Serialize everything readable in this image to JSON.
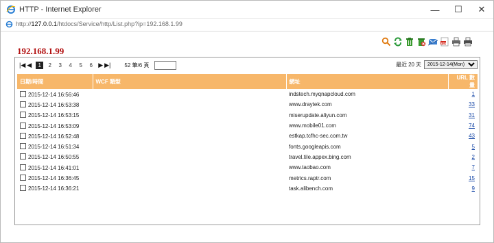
{
  "window": {
    "title": "HTTP - Internet Explorer",
    "minimize_glyph": "—",
    "maximize_glyph": "☐",
    "close_glyph": "✕"
  },
  "address_bar": {
    "url_prefix": "http://",
    "url_host": "127.0.0.1",
    "url_path": "/htdocs/Service/http/List.php?ip=192.168.1.99"
  },
  "page": {
    "ip_title": "192.168.1.99",
    "toolbar_icons": [
      "search-icon",
      "refresh-icon",
      "delete-icon",
      "delete-all-icon",
      "email-icon",
      "pdf-icon",
      "print-icon",
      "print-all-icon"
    ]
  },
  "pager": {
    "first": "|◀",
    "prev": "◀",
    "pages": [
      "1",
      "2",
      "3",
      "4",
      "5",
      "6"
    ],
    "current_page": "1",
    "next": "▶",
    "last": "▶|",
    "info": "52 筆/6 頁",
    "goto_value": ""
  },
  "recent": {
    "label_prefix": "最近",
    "days": "20",
    "label_suffix": "天",
    "date_selected": "2015-12-14(Mon)"
  },
  "table": {
    "columns": [
      "日期/時間",
      "WCF 類型",
      "網址",
      "URL 數量"
    ],
    "rows": [
      {
        "datetime": "2015-12-14 16:56:46",
        "wcf": "",
        "url": "indstech.myqnapcloud.com",
        "count": "1"
      },
      {
        "datetime": "2015-12-14 16:53:38",
        "wcf": "",
        "url": "www.draytek.com",
        "count": "33"
      },
      {
        "datetime": "2015-12-14 16:53:15",
        "wcf": "",
        "url": "miserupdate.aliyun.com",
        "count": "31"
      },
      {
        "datetime": "2015-12-14 16:53:09",
        "wcf": "",
        "url": "www.mobile01.com",
        "count": "74"
      },
      {
        "datetime": "2015-12-14 16:52:48",
        "wcf": "",
        "url": "estkap.tcfhc-sec.com.tw",
        "count": "43"
      },
      {
        "datetime": "2015-12-14 16:51:34",
        "wcf": "",
        "url": "fonts.googleapis.com",
        "count": "5"
      },
      {
        "datetime": "2015-12-14 16:50:55",
        "wcf": "",
        "url": "travel.tile.appex.bing.com",
        "count": "2"
      },
      {
        "datetime": "2015-12-14 16:41:01",
        "wcf": "",
        "url": "www.taobao.com",
        "count": "7"
      },
      {
        "datetime": "2015-12-14 16:36:45",
        "wcf": "",
        "url": "metrics.raptr.com",
        "count": "15"
      },
      {
        "datetime": "2015-12-14 16:36:21",
        "wcf": "",
        "url": "task.alibench.com",
        "count": "9"
      }
    ]
  },
  "colors": {
    "ip_title": "#b10d0d",
    "header_bg": "#f7b76a",
    "link": "#1a4aa8"
  }
}
